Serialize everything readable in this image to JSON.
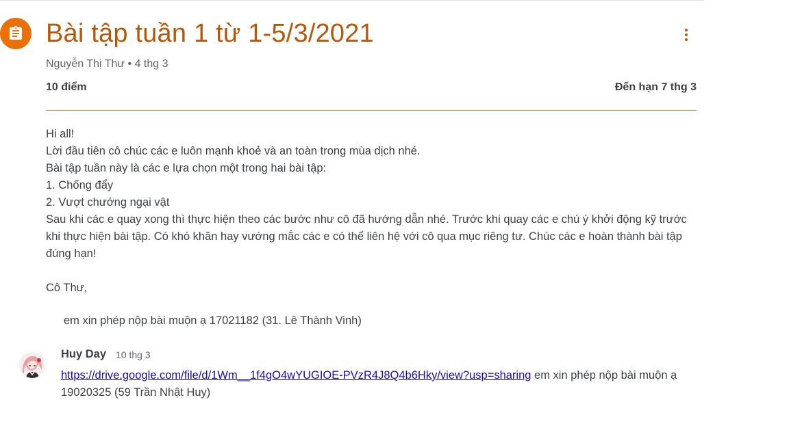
{
  "assignment": {
    "title": "Bài tập tuần 1 từ 1-5/3/2021",
    "author": "Nguyễn Thị Thư",
    "separator": " • ",
    "posted_date": "4 thg 3",
    "points": "10 điểm",
    "due": "Đến hạn 7 thg 3",
    "icon": "assignment-icon",
    "accent_color": "#e8710a",
    "title_color": "#b3590c"
  },
  "body": {
    "lines": [
      "Hi all!",
      "Lời đầu tiên cô chúc các e luôn mạnh khoẻ và an toàn trong mùa dịch nhé.",
      "Bài tập tuần này là các e lựa chọn một trong hai bài tập:",
      "1. Chống đẩy",
      "2. Vượt chướng ngại vật",
      "Sau khi các e quay xong thì thực hiện theo các bước như cô đã hướng dẫn nhé. Trước khi quay các e chú ý khởi động kỹ trước khi thực hiện bài tập. Có khó khăn hay vướng mắc các e có thể liên hệ với cô qua mục riêng tư. Chúc các e hoàn thành bài tập đúng hạn!",
      "Cô Thư,"
    ]
  },
  "comments": {
    "clipped_text": "em xin phép nộp bài muộn ạ 17021182 (31. Lê Thành Vinh)",
    "items": [
      {
        "author": "Huy Day",
        "date": "10 thg 3",
        "link": "https://drive.google.com/file/d/1Wm__1f4gO4wYUGIOE-PVzR4J8Q4b6Hky/view?usp=sharing",
        "text": " em xin phép nộp bài muộn ạ 19020325 (59 Trần Nhật Huy)"
      }
    ]
  }
}
